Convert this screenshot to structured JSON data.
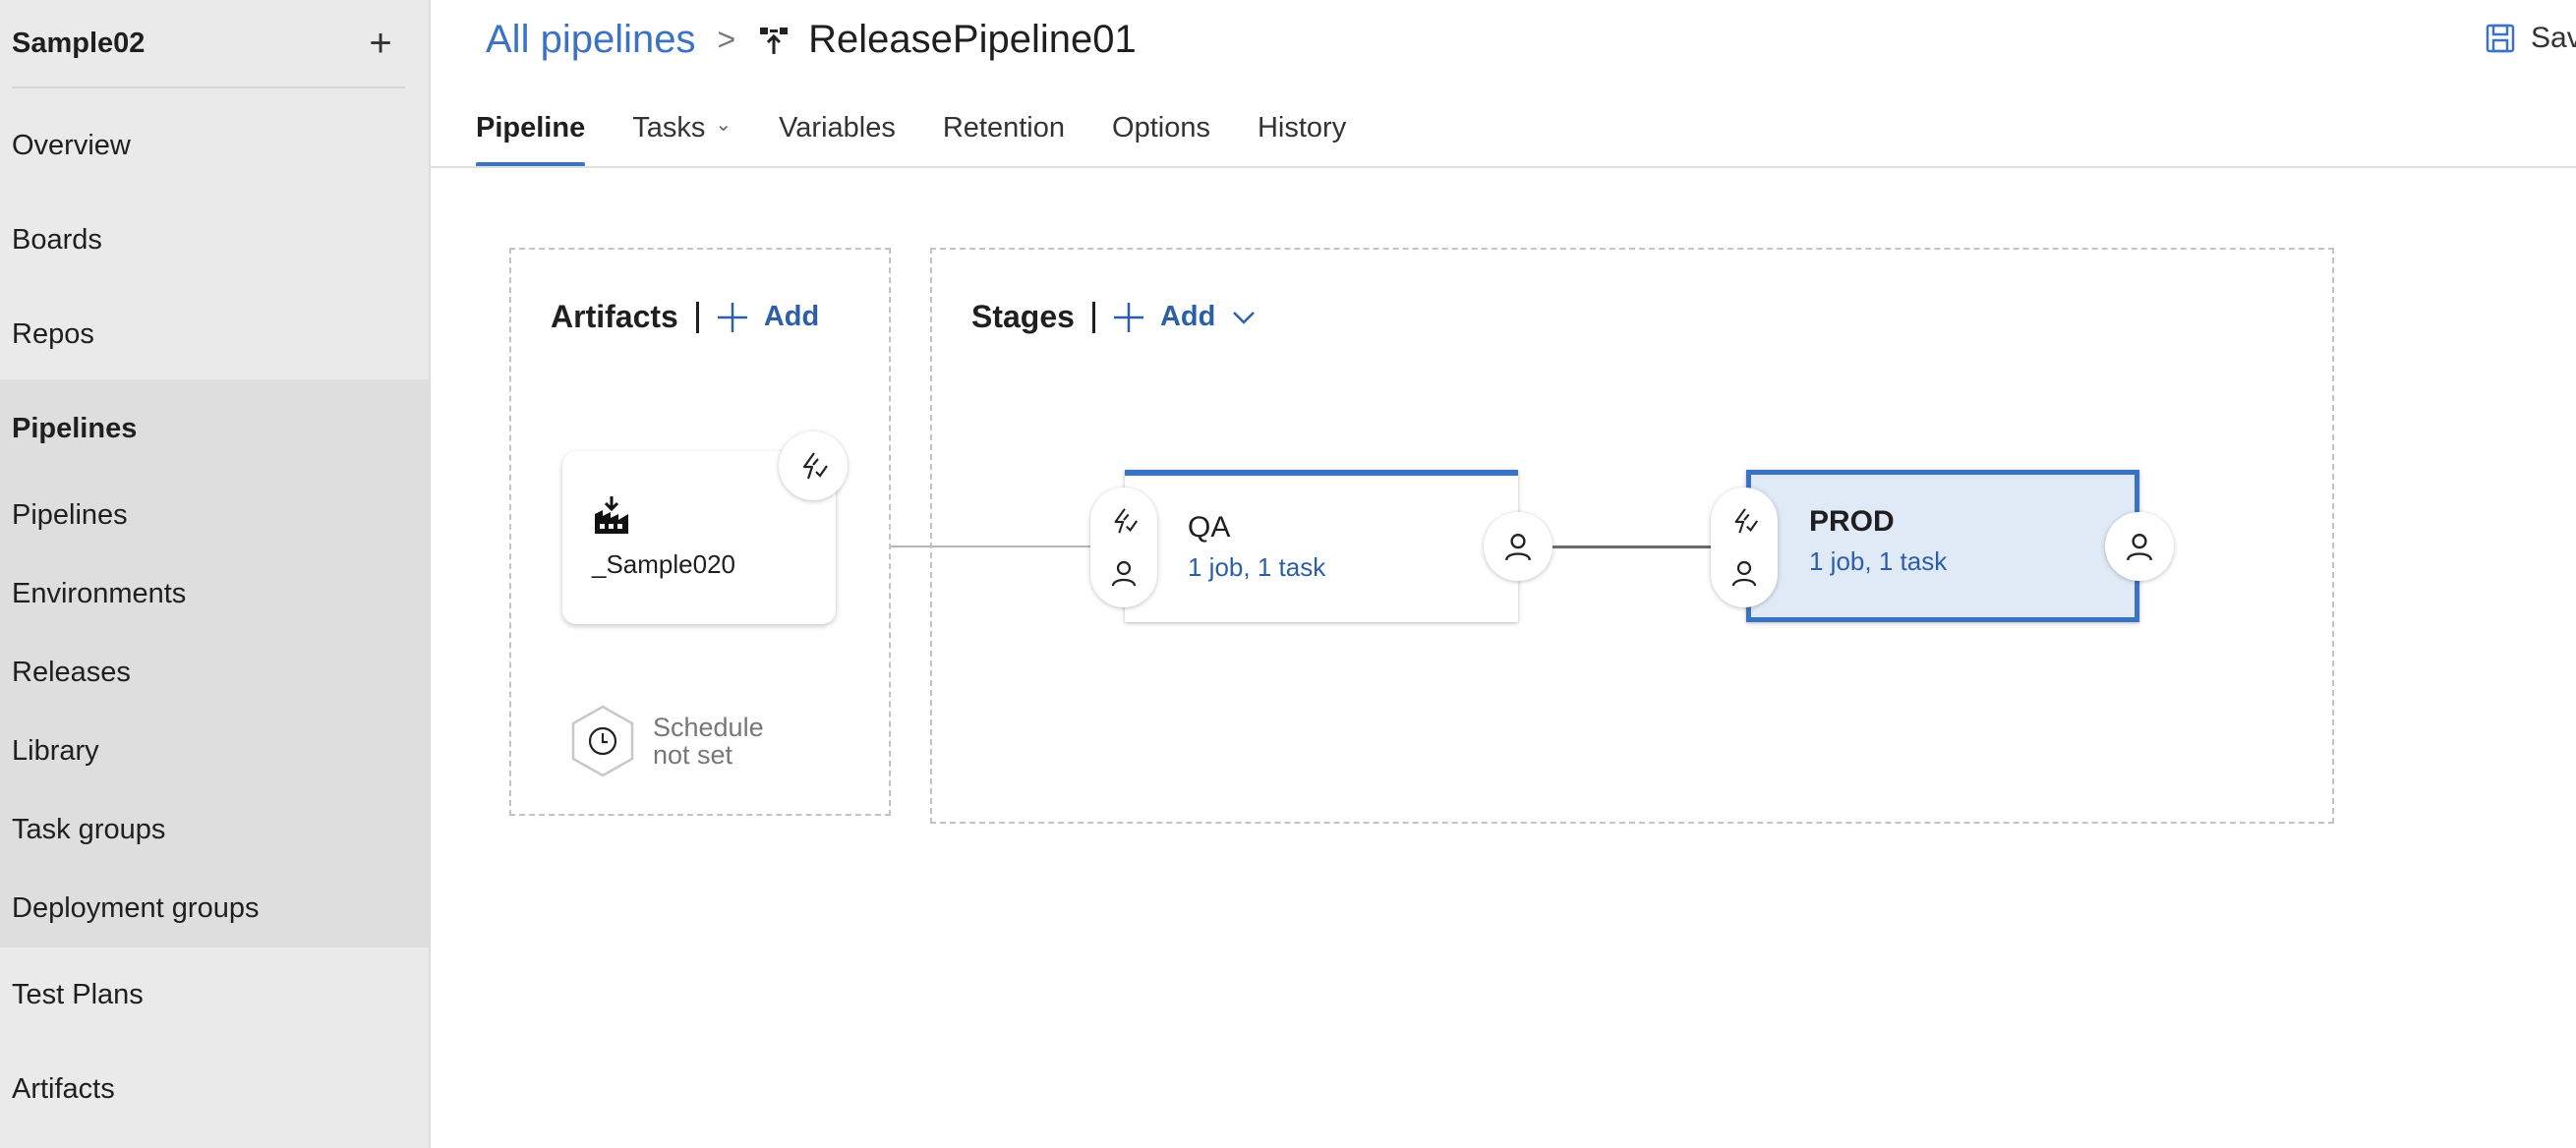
{
  "sidebar": {
    "project_name": "Sample02",
    "add_icon": "plus-icon",
    "items": {
      "overview": "Overview",
      "boards": "Boards",
      "repos": "Repos",
      "pipelines_group": "Pipelines",
      "pipelines": "Pipelines",
      "environments": "Environments",
      "releases": "Releases",
      "library": "Library",
      "task_groups": "Task groups",
      "deployment_groups": "Deployment groups",
      "test_plans": "Test Plans",
      "artifacts": "Artifacts"
    }
  },
  "header": {
    "breadcrumb_root": "All pipelines",
    "breadcrumb_separator": ">",
    "pipeline_icon": "release-pipeline-icon",
    "pipeline_name": "ReleasePipeline01",
    "save_label": "Sav",
    "save_icon": "save-icon"
  },
  "tabs": [
    {
      "label": "Pipeline",
      "active": true
    },
    {
      "label": "Tasks",
      "has_dropdown": true
    },
    {
      "label": "Variables"
    },
    {
      "label": "Retention"
    },
    {
      "label": "Options"
    },
    {
      "label": "History"
    }
  ],
  "tasks_caret": "⌄",
  "artifacts_panel": {
    "title": "Artifacts",
    "add_label": "Add",
    "artifact": {
      "name": "_Sample020",
      "icon": "build-artifact-icon",
      "trigger_icon": "continuous-deployment-trigger-icon"
    },
    "schedule": {
      "line1": "Schedule",
      "line2": "not set",
      "icon": "clock-icon"
    }
  },
  "stages_panel": {
    "title": "Stages",
    "add_label": "Add",
    "stages": [
      {
        "name": "QA",
        "summary": "1 job, 1 task",
        "selected": false
      },
      {
        "name": "PROD",
        "summary": "1 job, 1 task",
        "selected": true
      }
    ]
  },
  "colors": {
    "accent": "#3b73c4",
    "link": "#2c5fa8",
    "sidebar_bg": "#eaeaea",
    "sidebar_group_bg": "#dedede",
    "selected_stage_bg": "#e0e9f6"
  }
}
